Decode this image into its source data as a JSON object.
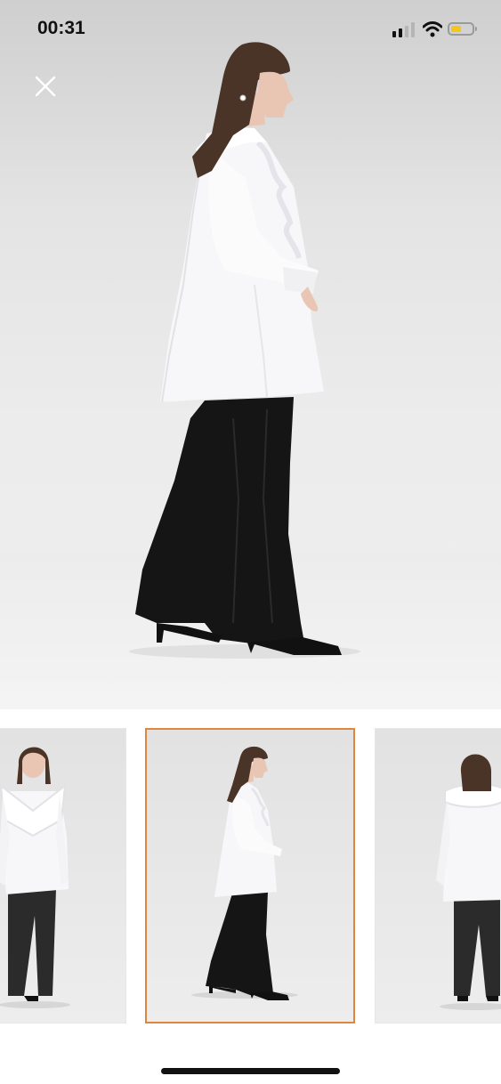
{
  "status_bar": {
    "time": "00:31",
    "signal_icon": "cellular-signal-icon",
    "signal_bars_active": 2,
    "signal_bars_total": 4,
    "wifi_icon": "wifi-icon",
    "battery_icon": "battery-icon",
    "battery_level": 0.5,
    "battery_color": "#f5c518"
  },
  "viewer": {
    "close_icon": "close-icon",
    "image": "model-side-view-white-ruffle-blouse-black-flared-trousers"
  },
  "thumbnails": {
    "selected_index": 1,
    "selected_border_color": "#e0863a",
    "items": [
      {
        "image": "model-front-view"
      },
      {
        "image": "model-side-view"
      },
      {
        "image": "model-back-view"
      }
    ]
  },
  "colors": {
    "blouse": "#f7f7f9",
    "trousers": "#151515",
    "hair": "#4a3427",
    "skin": "#e9c6b4",
    "shoes": "#111111"
  }
}
